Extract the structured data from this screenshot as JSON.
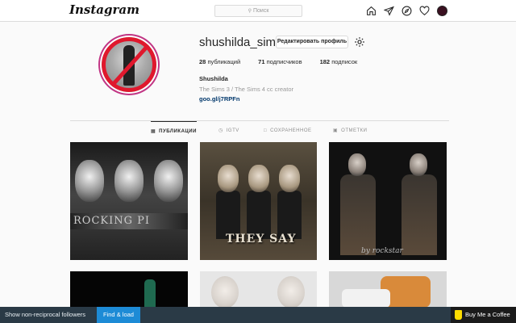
{
  "header": {
    "logo": "Instagram",
    "search_placeholder": "Поиск",
    "nav_icons": [
      "home-icon",
      "direct-icon",
      "explore-icon",
      "heart-icon"
    ]
  },
  "profile": {
    "username": "shushilda_sims",
    "edit_button": "Редактировать профиль",
    "stats": {
      "posts_count": "28",
      "posts_label": "публикаций",
      "followers_count": "71",
      "followers_label": "подписчиков",
      "following_count": "182",
      "following_label": "подписок"
    },
    "full_name": "Shushilda",
    "bio": "The Sims 3 / The Sims 4 cc creator",
    "link": "goo.gl/j7RPFn"
  },
  "tabs": [
    {
      "label": "ПУБЛИКАЦИИ",
      "active": true
    },
    {
      "label": "IGTV",
      "active": false
    },
    {
      "label": "СОХРАНЕННОЕ",
      "active": false
    },
    {
      "label": "ОТМЕТКИ",
      "active": false
    }
  ],
  "posts": {
    "post1_text": "ROCKING PI",
    "post2_text": "THEY SAY",
    "post3_text": "by rockstar"
  },
  "extension_bar": {
    "left_text": "Show non-reciprocal followers",
    "button": "Find & load",
    "coffee": "Buy Me a Coffee"
  }
}
